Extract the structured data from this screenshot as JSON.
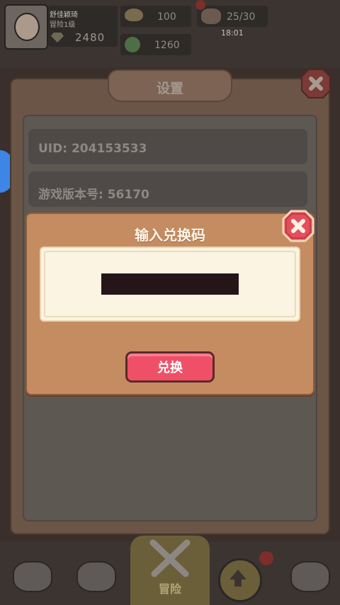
{
  "hud": {
    "player_name": "舒佳颖琦",
    "player_level": "冒险1级",
    "gems": "2480",
    "coins": "100",
    "heal": "1260",
    "energy": "25/30",
    "energy_timer": "18:01"
  },
  "settings": {
    "title": "设置",
    "uid_label": "UID: 204153533",
    "version_label": "游戏版本号: 56170"
  },
  "redeem_dialog": {
    "title": "输入兑换码",
    "code_value": "",
    "button_label": "兑换"
  },
  "bottom_nav": {
    "active_label": "冒险"
  },
  "colors": {
    "dialog_bg": "#c58c61",
    "button_red": "#ef5068",
    "close_red": "#e44f5c"
  }
}
